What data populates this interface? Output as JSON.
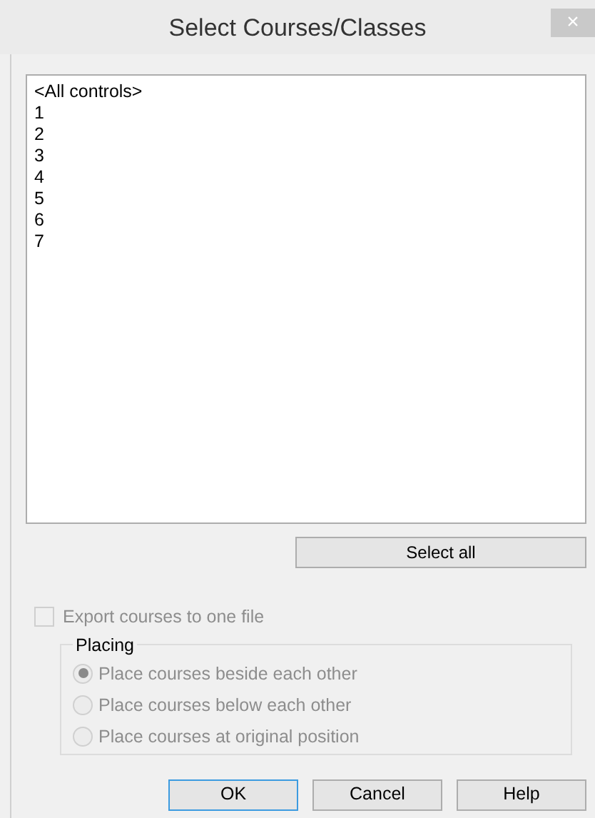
{
  "window": {
    "title": "Select Courses/Classes",
    "close": "×"
  },
  "list": {
    "items": [
      {
        "label": "<All controls>",
        "selected": false
      },
      {
        "label": "1",
        "selected": false
      },
      {
        "label": "2",
        "selected": false
      },
      {
        "label": "3",
        "selected": false
      },
      {
        "label": "4",
        "selected": false
      },
      {
        "label": "5",
        "selected": false
      },
      {
        "label": "6",
        "selected": false
      },
      {
        "label": "7",
        "selected": false
      }
    ]
  },
  "select_all_button": "Select all",
  "export_checkbox": {
    "label": "Export courses to one file",
    "checked": false,
    "disabled": true
  },
  "placing": {
    "title": "Placing",
    "options": [
      {
        "label": "Place courses beside each other",
        "selected": true,
        "disabled": true
      },
      {
        "label": "Place courses below each other",
        "selected": false,
        "disabled": true
      },
      {
        "label": "Place courses at original position",
        "selected": false,
        "disabled": true
      }
    ]
  },
  "buttons": [
    {
      "label": "OK",
      "default": true
    },
    {
      "label": "Cancel",
      "default": false
    },
    {
      "label": "Help",
      "default": false
    }
  ]
}
